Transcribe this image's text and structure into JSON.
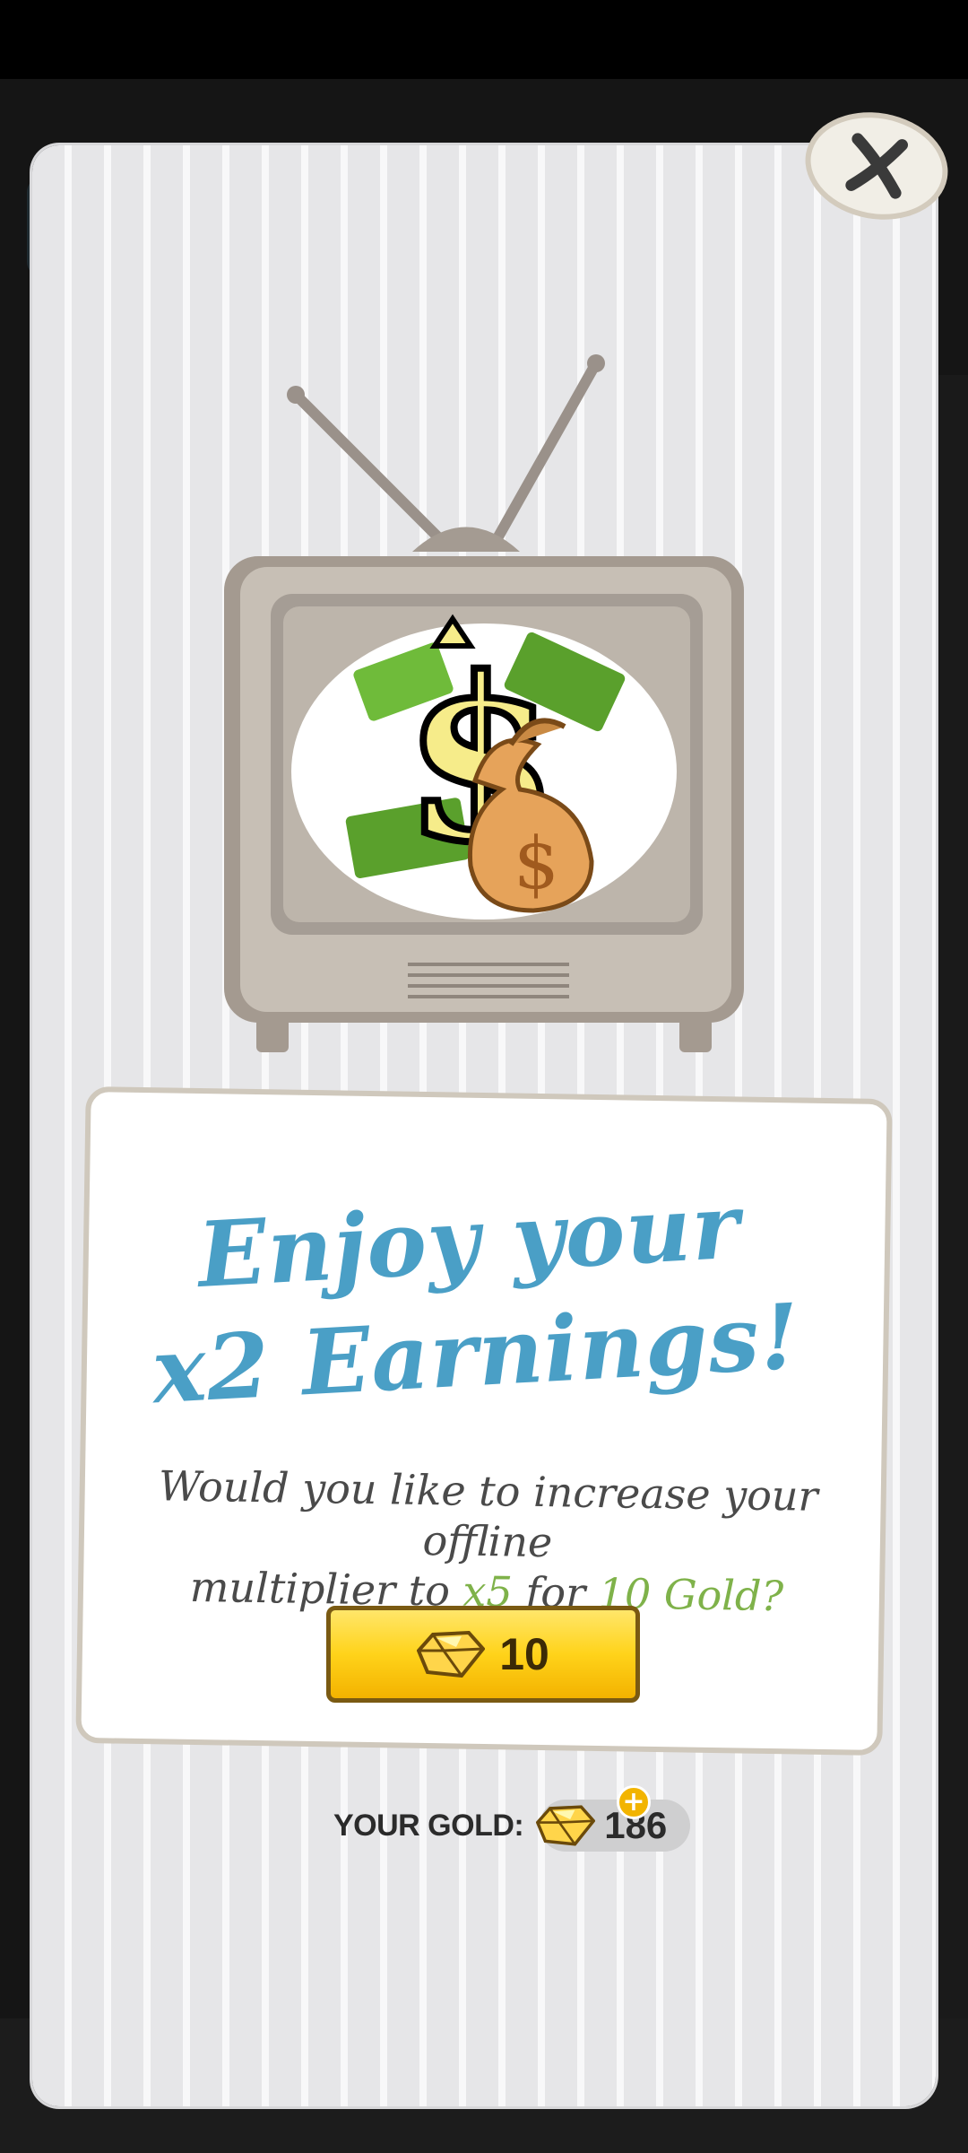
{
  "background": {
    "money_text": "$1"
  },
  "modal": {
    "title_line1": "Enjoy your",
    "title_line2": "x2 Earnings!",
    "message_part1": "Would you like to increase your offline",
    "message_part2": "multiplier to ",
    "message_multiplier": "x5",
    "message_part3": " for ",
    "message_price": "10 Gold?",
    "buy_button_label": "10",
    "gold_label": "YOUR GOLD:",
    "gold_amount": "186",
    "add_gold_symbol": "+"
  },
  "colors": {
    "title": "#4a9fc6",
    "highlight_green": "#7fb24a",
    "button_gold": "#ffd31a",
    "modal_stripes": "#e6e6e8"
  },
  "icons": {
    "close": "close-icon",
    "tv": "tv-icon",
    "gem": "gold-gem-icon",
    "add": "add-icon"
  }
}
